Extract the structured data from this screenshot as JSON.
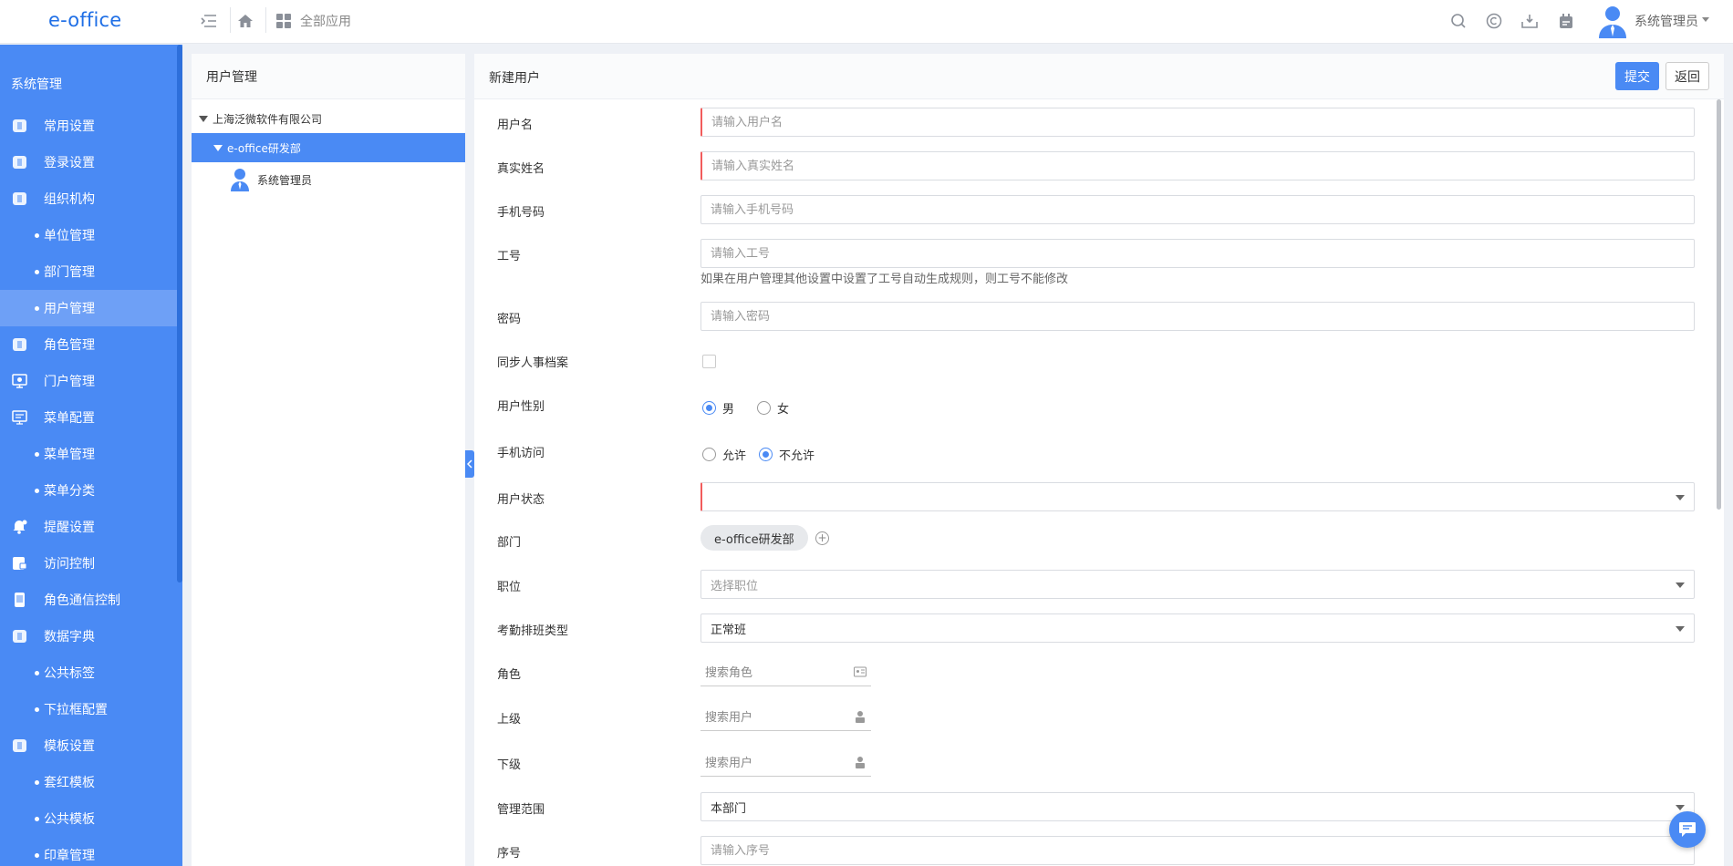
{
  "header": {
    "logo": "e-office",
    "all_apps_label": "全部应用",
    "user_name": "系统管理员",
    "icons": [
      "menu-toggle-icon",
      "home-icon",
      "grid-apps-icon",
      "search-icon",
      "copyright-icon",
      "download-icon",
      "calendar-icon"
    ]
  },
  "sidebar": {
    "title": "系统管理",
    "items": [
      {
        "label": "常用设置",
        "icon": "settings-square-icon",
        "type": "main"
      },
      {
        "label": "登录设置",
        "icon": "login-square-icon",
        "type": "main"
      },
      {
        "label": "组织机构",
        "icon": "org-square-icon",
        "type": "main"
      },
      {
        "label": "单位管理",
        "type": "sub"
      },
      {
        "label": "部门管理",
        "type": "sub"
      },
      {
        "label": "用户管理",
        "type": "sub",
        "active": true
      },
      {
        "label": "角色管理",
        "icon": "role-square-icon",
        "type": "main"
      },
      {
        "label": "门户管理",
        "icon": "portal-monitor-icon",
        "type": "main"
      },
      {
        "label": "菜单配置",
        "icon": "menu-monitor-icon",
        "type": "main"
      },
      {
        "label": "菜单管理",
        "type": "sub"
      },
      {
        "label": "菜单分类",
        "type": "sub"
      },
      {
        "label": "提醒设置",
        "icon": "bell-icon",
        "type": "main"
      },
      {
        "label": "访问控制",
        "icon": "lock-square-icon",
        "type": "main"
      },
      {
        "label": "角色通信控制",
        "icon": "phone-square-icon",
        "type": "main"
      },
      {
        "label": "数据字典",
        "icon": "dictionary-square-icon",
        "type": "main"
      },
      {
        "label": "公共标签",
        "type": "sub"
      },
      {
        "label": "下拉框配置",
        "type": "sub"
      },
      {
        "label": "模板设置",
        "icon": "template-square-icon",
        "type": "main"
      },
      {
        "label": "套红模板",
        "type": "sub"
      },
      {
        "label": "公共模板",
        "type": "sub"
      },
      {
        "label": "印章管理",
        "type": "sub"
      }
    ]
  },
  "tree": {
    "title": "用户管理",
    "company": "上海泛微软件有限公司",
    "department": "e-office研发部",
    "user": "系统管理员"
  },
  "form": {
    "title": "新建用户",
    "submit_label": "提交",
    "back_label": "返回",
    "fields": {
      "username": {
        "label": "用户名",
        "placeholder": "请输入用户名"
      },
      "realname": {
        "label": "真实姓名",
        "placeholder": "请输入真实姓名"
      },
      "mobile": {
        "label": "手机号码",
        "placeholder": "请输入手机号码"
      },
      "job_no": {
        "label": "工号",
        "placeholder": "请输入工号",
        "help": "如果在用户管理其他设置中设置了工号自动生成规则，则工号不能修改"
      },
      "password": {
        "label": "密码",
        "placeholder": "请输入密码"
      },
      "sync_hr": {
        "label": "同步人事档案",
        "checked": false
      },
      "gender": {
        "label": "用户性别",
        "options": [
          "男",
          "女"
        ],
        "selected": "男"
      },
      "mobile_access": {
        "label": "手机访问",
        "options": [
          "允许",
          "不允许"
        ],
        "selected": "不允许"
      },
      "status": {
        "label": "用户状态",
        "value": ""
      },
      "department": {
        "label": "部门",
        "value": "e-office研发部"
      },
      "position": {
        "label": "职位",
        "placeholder": "选择职位"
      },
      "attendance": {
        "label": "考勤排班类型",
        "value": "正常班"
      },
      "role": {
        "label": "角色",
        "placeholder": "搜索角色"
      },
      "superior": {
        "label": "上级",
        "placeholder": "搜索用户"
      },
      "subordinate": {
        "label": "下级",
        "placeholder": "搜索用户"
      },
      "scope": {
        "label": "管理范围",
        "value": "本部门"
      },
      "order": {
        "label": "序号",
        "placeholder": "请输入序号"
      }
    }
  },
  "colors": {
    "brand": "#4a8af4",
    "required": "#f25c5c",
    "logo": "#1f6fe6"
  }
}
